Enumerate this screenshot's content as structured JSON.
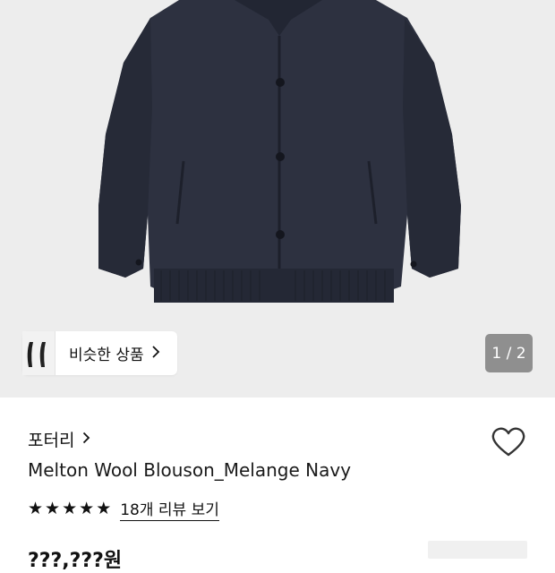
{
  "gallery": {
    "similar_label": "비슷한 상품",
    "counter": "1 / 2"
  },
  "product": {
    "brand": "포터리",
    "name": "Melton Wool Blouson_Melange Navy",
    "rating": 5,
    "reviews_link": "18개 리뷰 보기",
    "price_partial": "???,???원"
  },
  "colors": {
    "jacket": "#2d3140",
    "hero_bg": "#ededed",
    "counter_bg": "#8f8f8f"
  },
  "icons": [
    "chevron-right-icon",
    "heart-icon",
    "star-icon"
  ]
}
